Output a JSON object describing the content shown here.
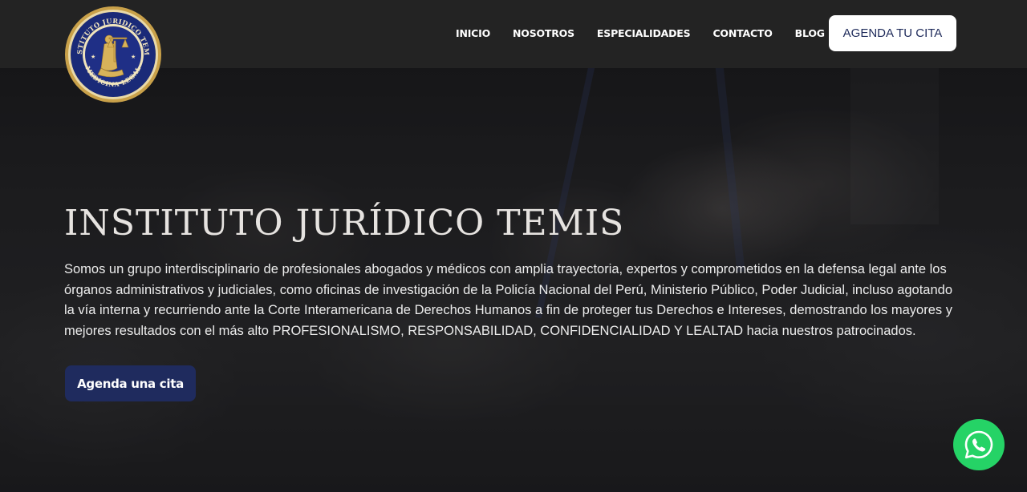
{
  "brand": {
    "name": "INSTITUTO JURÍDICO TEMIS",
    "logo_text_top": "INSTITUTO JURIDICO TEMIS",
    "logo_text_bottom": "MEDICINA LEGAL",
    "colors": {
      "primary_navy": "#1f2b5e",
      "gold": "#c9a14a",
      "header_bg": "#232323",
      "whatsapp_green": "#25d366"
    }
  },
  "nav": {
    "items": [
      {
        "label": "INICIO"
      },
      {
        "label": "NOSOTROS"
      },
      {
        "label": "ESPECIALIDADES"
      },
      {
        "label": "CONTACTO"
      },
      {
        "label": "BLOG"
      }
    ],
    "cta_label": "AGENDA TU CITA"
  },
  "hero": {
    "title": "INSTITUTO JURÍDICO TEMIS",
    "description": "Somos un grupo interdisciplinario de profesionales abogados y médicos con amplia trayectoria, expertos y comprometidos en la defensa legal ante los órganos administrativos y judiciales, como oficinas de investigación de la Policía Nacional del Perú, Ministerio Público, Poder Judicial, incluso agotando la vía interna y recurriendo ante la Corte Interamericana de Derechos Humanos a fin de proteger tus Derechos e Intereses, demostrando los mayores y mejores resultados con el más alto PROFESIONALISMO, RESPONSABILIDAD, CONFIDENCIALIDAD Y LEALTAD hacia nuestros patrocinados.",
    "button_label": "Agenda una cita"
  },
  "floating": {
    "icon": "whatsapp-icon"
  }
}
